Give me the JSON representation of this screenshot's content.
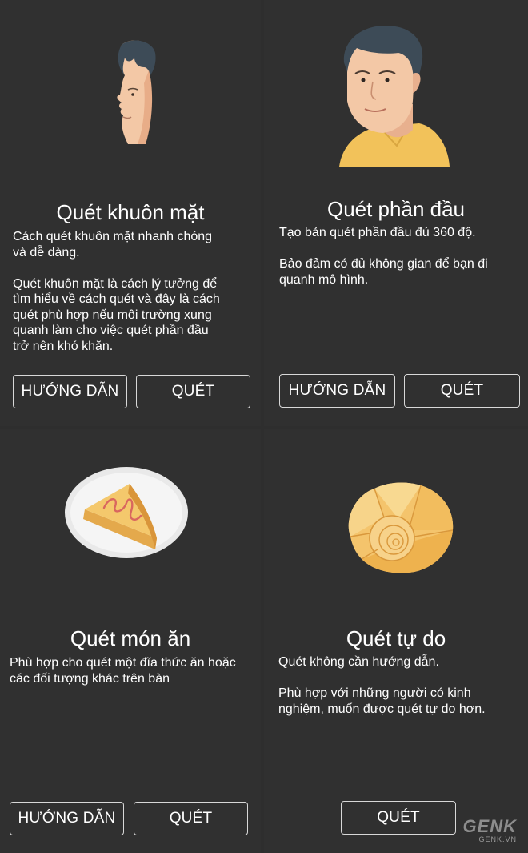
{
  "cards": [
    {
      "title": "Quét khuôn mặt",
      "description": "Cách quét khuôn mặt nhanh chóng\nvà dễ dàng.\n\nQuét khuôn mặt là cách lý tưởng để\ntìm hiểu về cách quét và đây là cách\nquét phù hợp nếu môi trường xung\nquanh làm cho việc quét phần đầu\ntrở nên khó khăn.",
      "guide_label": "HƯỚNG DẪN",
      "scan_label": "QUÉT",
      "icon": "face-profile-icon"
    },
    {
      "title": "Quét phần đầu",
      "description": "Tạo bản quét phần đầu đủ 360 độ.\n\nBảo đảm có đủ không gian để bạn đi\nquanh mô hình.",
      "guide_label": "HƯỚNG DẪN",
      "scan_label": "QUÉT",
      "icon": "head-bust-icon"
    },
    {
      "title": "Quét món ăn",
      "description": "Phù hợp cho quét một đĩa thức ăn hoặc\ncác đối tượng khác trên bàn",
      "guide_label": "HƯỚNG DẪN",
      "scan_label": "QUÉT",
      "icon": "cake-plate-icon"
    },
    {
      "title": "Quét tự do",
      "description": "Quét không cần hướng dẫn.\n\nPhù hợp với những người có kinh\nnghiệm, muốn được quét tự do hơn.",
      "scan_label": "QUÉT",
      "icon": "seashell-icon"
    }
  ],
  "watermark": {
    "logo": "GENK",
    "site": "GENK.VN"
  },
  "colors": {
    "background": "#2e2e2e",
    "panel": "#303030",
    "text": "#ffffff",
    "button_border": "#d8d8d8"
  }
}
